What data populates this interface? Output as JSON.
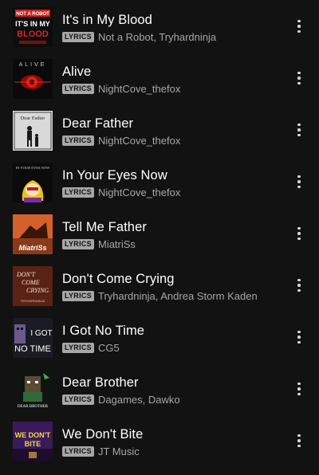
{
  "lyrics_badge": "LYRICS",
  "tracks": [
    {
      "title": "It's in My Blood",
      "artists": "Not a Robot, Tryhardninja",
      "art_text": [
        "NOT A ROBOT",
        "IT'S IN MY",
        "BLOOD"
      ]
    },
    {
      "title": "Alive",
      "artists": "NightCove_thefox",
      "art_text": [
        "ALIVE"
      ]
    },
    {
      "title": "Dear Father",
      "artists": "NightCove_thefox",
      "art_text": [
        "Dear Father"
      ]
    },
    {
      "title": "In Your Eyes Now",
      "artists": "NightCove_thefox",
      "art_text": [
        "IN YOUR EYES NOW"
      ]
    },
    {
      "title": "Tell Me Father",
      "artists": "MiatriSs",
      "art_text": [
        "MiatriSs"
      ]
    },
    {
      "title": "Don't Come Crying",
      "artists": "Tryhardninja, Andrea Storm Kaden",
      "art_text": [
        "DON'T",
        "COME",
        "CRYING",
        "TRYHARDNINJA"
      ]
    },
    {
      "title": "I Got No Time",
      "artists": "CG5",
      "art_text": [
        "I GOT",
        "NO TIME"
      ]
    },
    {
      "title": "Dear Brother",
      "artists": "Dagames, Dawko",
      "art_text": [
        "DEAR BROTHER"
      ]
    },
    {
      "title": "We Don't Bite",
      "artists": "JT Music",
      "art_text": [
        "WE DON'T",
        "BITE"
      ]
    }
  ],
  "icons": {
    "more": "more-vertical-icon"
  },
  "colors": {
    "background": "#121212",
    "title": "#ffffff",
    "secondary": "#a7a7a7",
    "badge_bg": "#a7a7a7"
  }
}
